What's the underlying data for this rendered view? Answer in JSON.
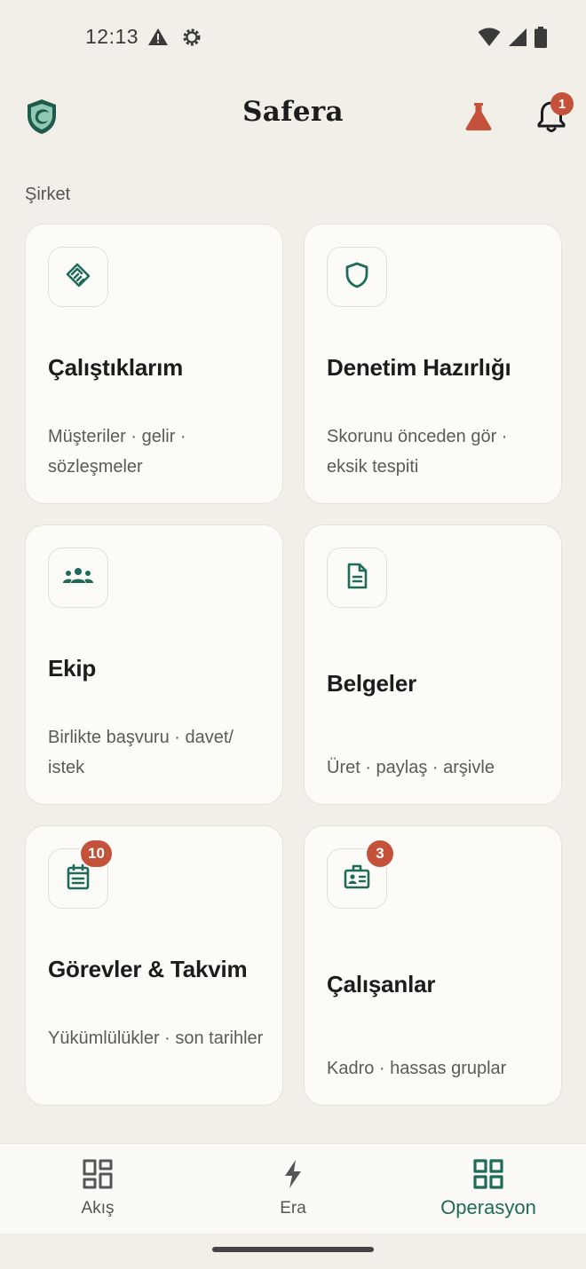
{
  "status_bar": {
    "time": "12:13",
    "left_icons": [
      "warning-icon",
      "settings-gear-icon"
    ],
    "right_icons": [
      "wifi-icon",
      "signal-icon",
      "battery-icon"
    ]
  },
  "header": {
    "title": "Safera",
    "logo_icon": "shield-logo-icon",
    "flask_icon": "flask-icon",
    "bell_icon": "bell-icon",
    "notification_count": "1"
  },
  "section": {
    "label": "Şirket"
  },
  "cards": [
    {
      "title": "Çalıştıklarım",
      "subtitle": "Müşteriler · gelir · sözleşmeler",
      "icon": "handshake-icon",
      "badge": null
    },
    {
      "title": "Denetim Hazırlığı",
      "subtitle": "Skorunu önceden gör · eksik tespiti",
      "icon": "shield-icon",
      "badge": null
    },
    {
      "title": "Ekip",
      "subtitle": "Birlikte başvuru · davet/ istek",
      "icon": "team-icon",
      "badge": null
    },
    {
      "title": "Belgeler",
      "subtitle": "Üret · paylaş · arşivle",
      "icon": "document-icon",
      "badge": null
    },
    {
      "title": "Görevler & Takvim",
      "subtitle": "Yükümlülükler · son tarihler",
      "icon": "calendar-icon",
      "badge": "10"
    },
    {
      "title": "Çalışanlar",
      "subtitle": "Kadro · hassas gruplar",
      "icon": "id-badge-icon",
      "badge": "3"
    }
  ],
  "bottom_nav": [
    {
      "label": "Akış",
      "icon": "dashboard-icon",
      "active": false
    },
    {
      "label": "Era",
      "icon": "lightning-icon",
      "active": false
    },
    {
      "label": "Operasyon",
      "icon": "grid-icon",
      "active": true
    }
  ],
  "colors": {
    "background": "#f2efe9",
    "card": "#fcfbf7",
    "accent_green": "#1f6b5a",
    "badge_red": "#c4523a"
  }
}
